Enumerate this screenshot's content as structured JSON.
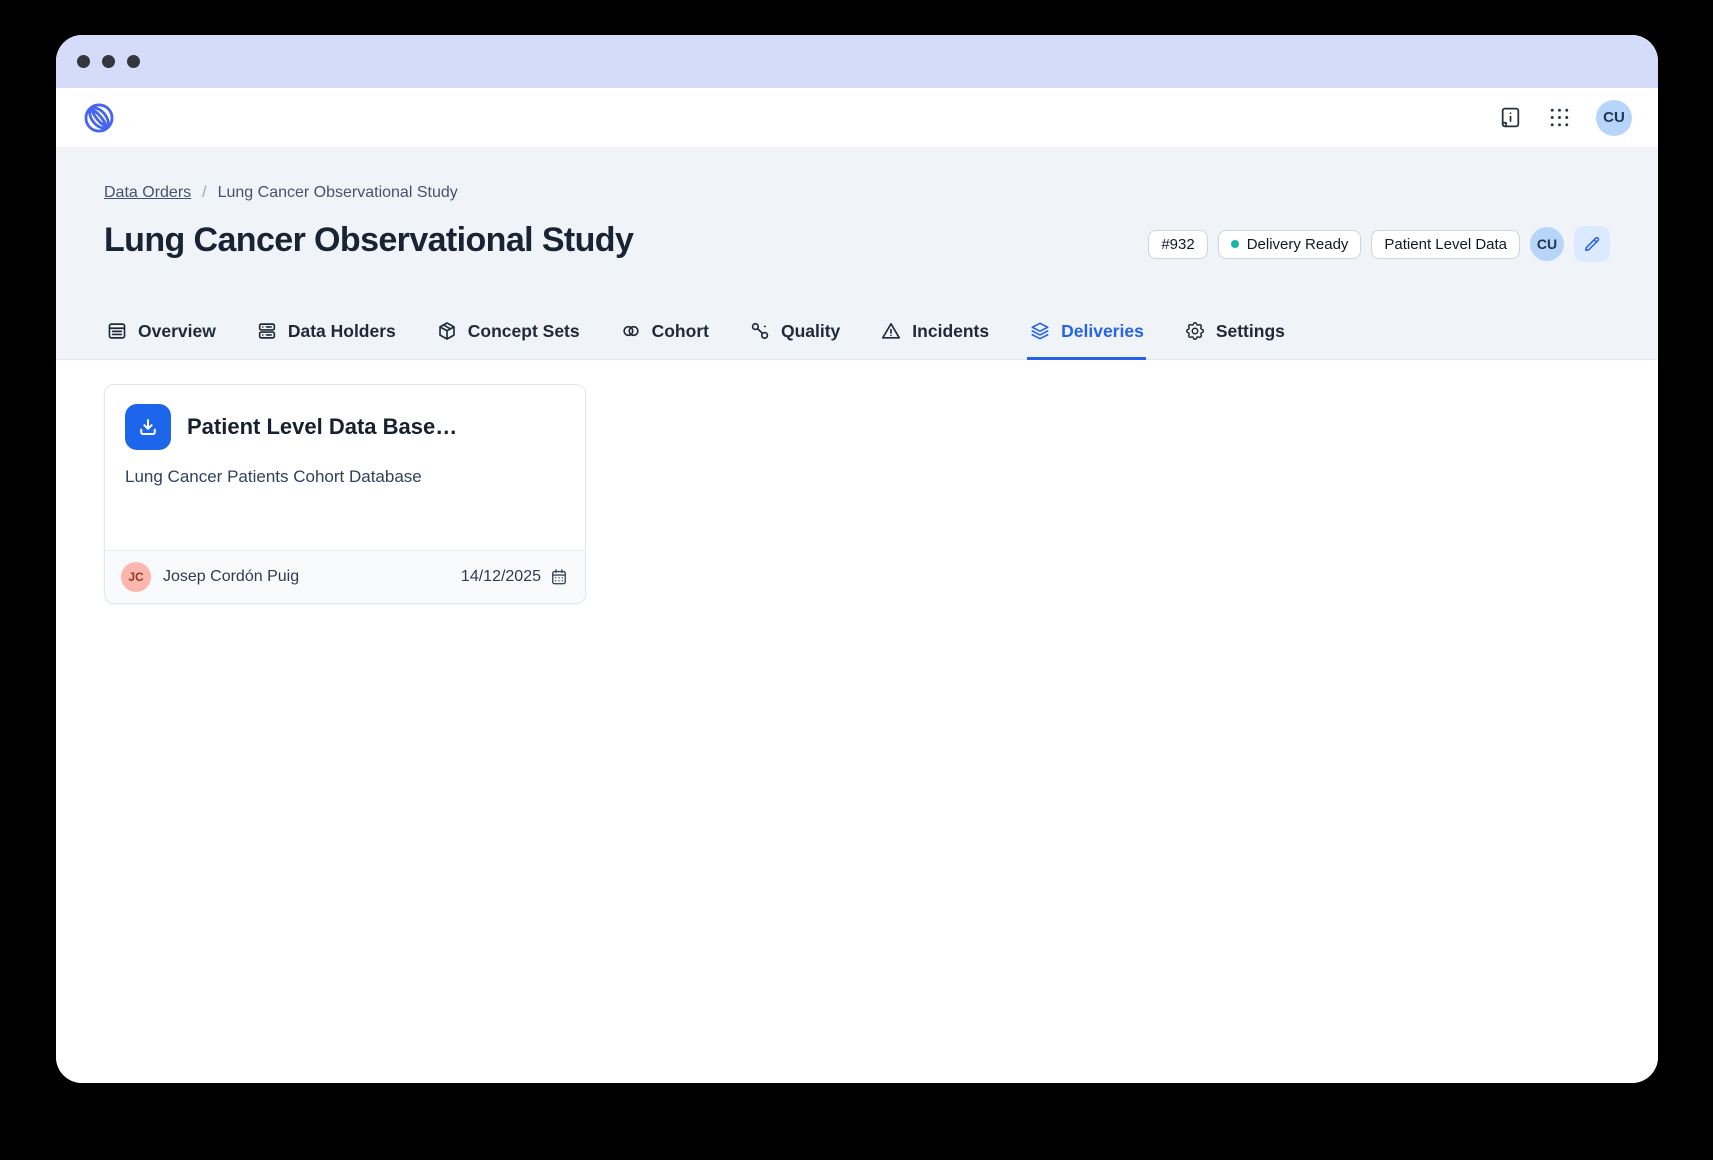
{
  "colors": {
    "accent": "#2563eb",
    "titlebar": "#d5dcf9",
    "status_dot": "#14b8a6",
    "download_tile": "#1d66ec",
    "cu_avatar_bg": "#b7d5f8",
    "jc_avatar_bg": "#fbb7ad"
  },
  "appbar": {
    "user_initials": "CU"
  },
  "breadcrumb": {
    "parent": "Data Orders",
    "separator": "/",
    "current": "Lung Cancer Observational Study"
  },
  "page": {
    "title": "Lung Cancer Observational Study",
    "id_badge": "#932",
    "status_badge": "Delivery Ready",
    "type_badge": "Patient Level Data",
    "owner_initials": "CU"
  },
  "tabs": [
    {
      "label": "Overview"
    },
    {
      "label": "Data Holders"
    },
    {
      "label": "Concept Sets"
    },
    {
      "label": "Cohort"
    },
    {
      "label": "Quality"
    },
    {
      "label": "Incidents"
    },
    {
      "label": "Deliveries",
      "active": true
    },
    {
      "label": "Settings"
    }
  ],
  "deliveries": {
    "card": {
      "title": "Patient Level Data Base…",
      "description": "Lung Cancer Patients Cohort Database",
      "owner_initials": "JC",
      "owner_name": "Josep Cordón Puig",
      "date": "14/12/2025"
    }
  }
}
